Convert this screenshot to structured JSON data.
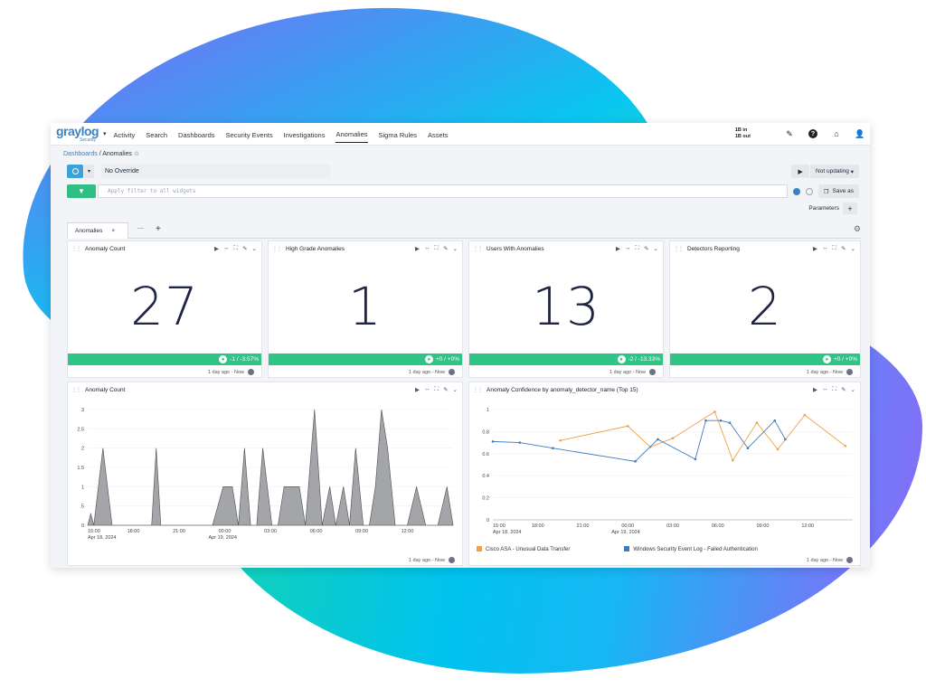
{
  "nav": {
    "logo": "graylog",
    "logo_sub": "Security",
    "items": [
      "Activity",
      "Search",
      "Dashboards",
      "Security Events",
      "Investigations",
      "Anomalies",
      "Sigma Rules",
      "Assets"
    ],
    "active": "Anomalies",
    "traffic_in": "1B in",
    "traffic_out": "1B out"
  },
  "breadcrumb": {
    "parent": "Dashboards",
    "sep": "/",
    "current": "Anomalies"
  },
  "search": {
    "override": "No Override",
    "refresh": "Not updating",
    "query_placeholder": "Apply filter to all widgets",
    "save_label": "Save as",
    "parameters_label": "Parameters"
  },
  "tabs": {
    "active": "Anomalies",
    "other": "—"
  },
  "stat_widgets": [
    {
      "title": "Anomaly Count",
      "value": "27",
      "trend": "-1 / -3.57%",
      "range": "1 day ago - Now"
    },
    {
      "title": "High Grade Anomalies",
      "value": "1",
      "trend": "+0 / +0%",
      "range": "1 day ago - Now"
    },
    {
      "title": "Users With Anomalies",
      "value": "13",
      "trend": "-2 / -13.33%",
      "range": "1 day ago - Now"
    },
    {
      "title": "Detectors Reporting",
      "value": "2",
      "trend": "+0 / +0%",
      "range": "1 day ago - Now"
    }
  ],
  "area_widget": {
    "title": "Anomaly Count",
    "range": "1 day ago - Now"
  },
  "line_widget": {
    "title": "Anomaly Confidence by anomaly_detector_name (Top 15)",
    "range": "1 day ago - Now"
  },
  "chart_data": [
    {
      "type": "area",
      "title": "Anomaly Count",
      "ylim": [
        0,
        3
      ],
      "yticks": [
        "0",
        ".5",
        "1",
        "1.5",
        "2",
        "2.5",
        "3"
      ],
      "xticks": [
        "15:00",
        "18:00",
        "21:00",
        "00:00",
        "03:00",
        "06:00",
        "09:00",
        "12:00"
      ],
      "xsub": [
        "Apr 18, 2024",
        "",
        "",
        "Apr 19, 2024",
        "",
        "",
        "",
        ""
      ],
      "x_hours": [
        0,
        0.2,
        0.4,
        1.0,
        1.6,
        2.2,
        4.2,
        4.5,
        4.8,
        5.1,
        5.4,
        5.7,
        8.2,
        8.9,
        9.5,
        9.9,
        10.3,
        10.7,
        11.1,
        11.5,
        12.1,
        12.5,
        12.9,
        13.4,
        13.9,
        14.3,
        14.9,
        15.4,
        15.9,
        16.3,
        16.8,
        17.2,
        17.6,
        18.1,
        18.5,
        18.9,
        19.3,
        19.7,
        20.2,
        20.6,
        21.0,
        21.6,
        22.2,
        22.6,
        23.0,
        23.6,
        24.0
      ],
      "y_values": [
        0,
        0.3,
        0,
        2,
        0,
        0,
        0,
        2,
        0,
        0,
        0,
        0,
        0,
        1,
        1,
        0,
        2,
        0,
        0,
        2,
        0,
        0,
        1,
        1,
        1,
        0,
        3,
        0,
        1,
        0,
        1,
        0,
        2,
        0,
        0,
        1,
        3,
        2,
        0,
        0,
        0,
        1,
        0,
        0,
        0,
        1,
        0
      ]
    },
    {
      "type": "line",
      "title": "Anomaly Confidence by anomaly_detector_name (Top 15)",
      "ylim": [
        0,
        1
      ],
      "yticks": [
        "0",
        "0.2",
        "0.4",
        "0.6",
        "0.8",
        "1"
      ],
      "xticks": [
        "15:00",
        "18:00",
        "21:00",
        "00:00",
        "03:00",
        "06:00",
        "09:00",
        "12:00"
      ],
      "xsub": [
        "Apr 18, 2024",
        "",
        "",
        "Apr 19, 2024",
        "",
        "",
        "",
        ""
      ],
      "series": [
        {
          "name": "Cisco ASA - Unusual Data Transfer",
          "color": "#f0a04b",
          "x_hours": [
            4.5,
            9.0,
            10.5,
            12.0,
            14.8,
            16.0,
            17.6,
            19.0,
            20.8,
            23.5
          ],
          "y_values": [
            0.72,
            0.85,
            0.66,
            0.74,
            0.98,
            0.54,
            0.88,
            0.64,
            0.95,
            0.67
          ]
        },
        {
          "name": "Windows Security Event Log - Failed Authentication",
          "color": "#3f7cbf",
          "x_hours": [
            0,
            1.8,
            4.0,
            9.5,
            11.0,
            13.5,
            14.2,
            15.2,
            15.8,
            17.0,
            18.8,
            19.5
          ],
          "y_values": [
            0.71,
            0.7,
            0.65,
            0.53,
            0.73,
            0.55,
            0.9,
            0.9,
            0.88,
            0.65,
            0.9,
            0.73
          ]
        }
      ]
    }
  ]
}
